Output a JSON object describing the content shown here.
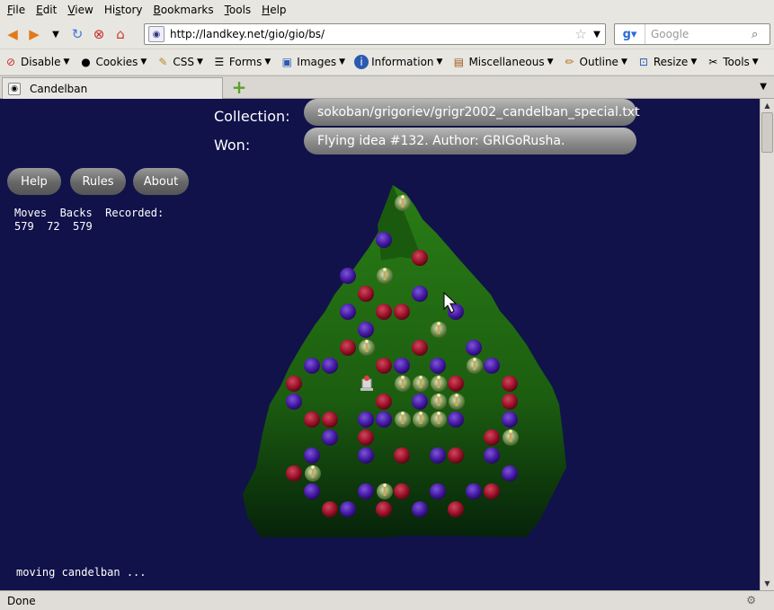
{
  "menubar": {
    "items": [
      {
        "first": "F",
        "rest": "ile"
      },
      {
        "first": "E",
        "rest": "dit"
      },
      {
        "first": "V",
        "rest": "iew"
      },
      {
        "first": "",
        "rest": "Hi",
        "u": "s",
        "tail": "tory"
      },
      {
        "first": "B",
        "rest": "ookmarks"
      },
      {
        "first": "T",
        "rest": "ools"
      },
      {
        "first": "H",
        "rest": "elp"
      }
    ]
  },
  "nav": {
    "url": "http://landkey.net/gio/gio/bs/",
    "search_placeholder": "Google"
  },
  "devbar": {
    "items": [
      "Disable",
      "Cookies",
      "CSS",
      "Forms",
      "Images",
      "Information",
      "Miscellaneous",
      "Outline",
      "Resize",
      "Tools"
    ]
  },
  "tab": {
    "title": "Candelban"
  },
  "game": {
    "collection_label": "Collection:",
    "collection_value": "sokoban/grigoriev/grigr2002_candelban_special.txt",
    "won_label": "Won:",
    "won_value": "Flying idea #132. Author: GRIGoRusha.",
    "buttons": {
      "help": "Help",
      "rules": "Rules",
      "about": "About"
    },
    "stats_header": "Moves  Backs  Recorded:",
    "stats_values": "579  72  579",
    "status_msg": "moving candelban ...",
    "colors": {
      "bg": "#11124a",
      "tree": "#1f6b12",
      "red": "#a3122c",
      "purple": "#4a1aa8"
    }
  },
  "status": {
    "text": "Done"
  }
}
